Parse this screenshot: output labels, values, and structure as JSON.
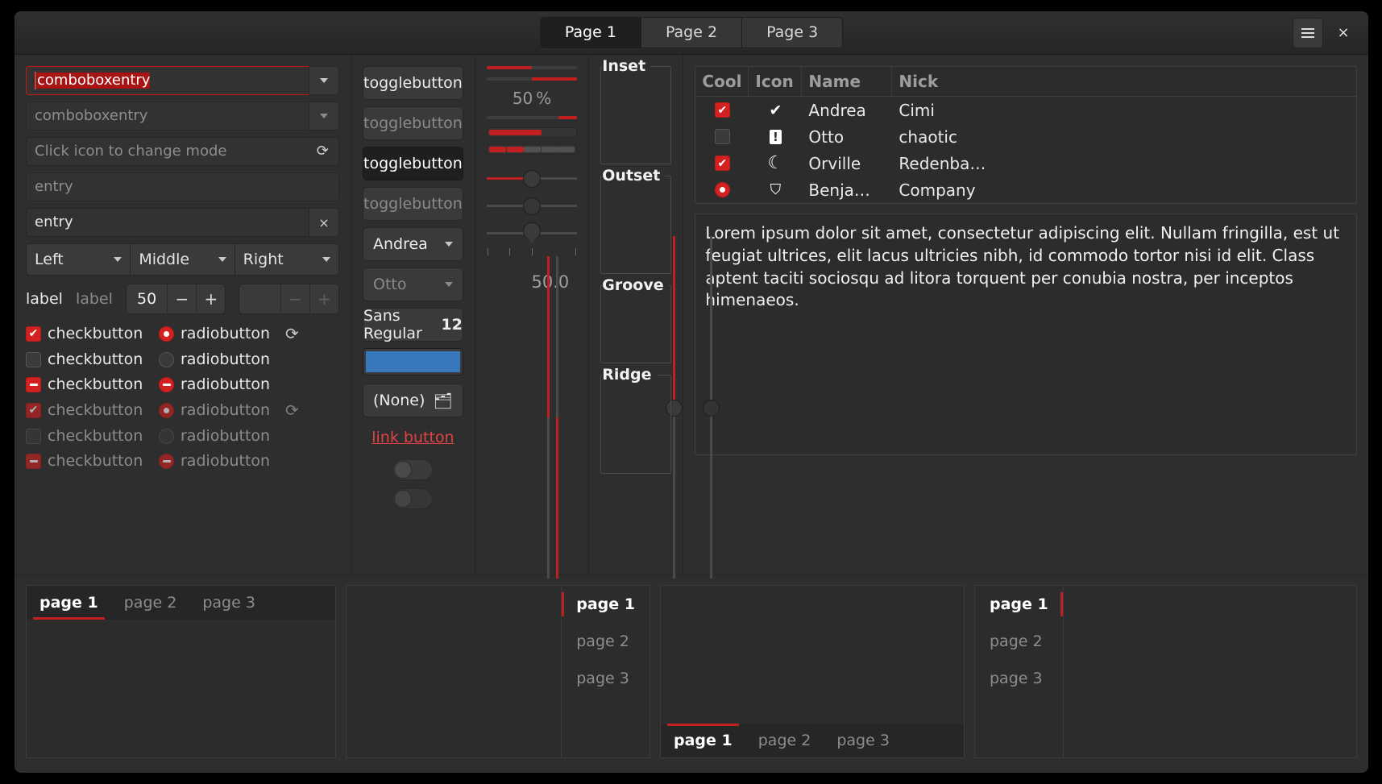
{
  "header": {
    "tabs": [
      {
        "label": "Page 1",
        "active": true
      },
      {
        "label": "Page 2",
        "active": false
      },
      {
        "label": "Page 3",
        "active": false
      }
    ],
    "menu_icon": "hamburger-menu-icon",
    "close_label": "×"
  },
  "col1": {
    "combo_entry_focused": {
      "value": "comboboxentry",
      "selected_text": "comboboxentry"
    },
    "combo_entry_placeholder": {
      "placeholder": "comboboxentry"
    },
    "icon_entry": {
      "placeholder": "Click icon to change mode",
      "icon": "refresh-icon"
    },
    "entry_placeholder": {
      "placeholder": "entry"
    },
    "entry_with_clear": {
      "value": "entry",
      "clear_icon": "×"
    },
    "segmented": [
      {
        "label": "Left"
      },
      {
        "label": "Middle"
      },
      {
        "label": "Right"
      }
    ],
    "labels": {
      "normal": "label",
      "dim": "label"
    },
    "spin": {
      "value": "50",
      "minus": "−",
      "plus": "+"
    },
    "spin_disabled": {
      "value": "",
      "minus": "−",
      "plus": "+"
    },
    "check_rows": [
      {
        "check_state": "on",
        "check_label": "checkbutton",
        "radio_state": "on",
        "radio_label": "radiobutton",
        "spinner": true,
        "disabled": false
      },
      {
        "check_state": "off",
        "check_label": "checkbutton",
        "radio_state": "off",
        "radio_label": "radiobutton",
        "spinner": false,
        "disabled": false
      },
      {
        "check_state": "mixed",
        "check_label": "checkbutton",
        "radio_state": "mixed",
        "radio_label": "radiobutton",
        "spinner": false,
        "disabled": false
      },
      {
        "check_state": "on",
        "check_label": "checkbutton",
        "radio_state": "on",
        "radio_label": "radiobutton",
        "spinner": true,
        "disabled": true
      },
      {
        "check_state": "off",
        "check_label": "checkbutton",
        "radio_state": "off",
        "radio_label": "radiobutton",
        "spinner": false,
        "disabled": true
      },
      {
        "check_state": "mixed",
        "check_label": "checkbutton",
        "radio_state": "mixed",
        "radio_label": "radiobutton",
        "spinner": false,
        "disabled": true
      }
    ]
  },
  "col2": {
    "toggles": [
      {
        "label": "togglebutton",
        "state": "normal"
      },
      {
        "label": "togglebutton",
        "state": "disabled"
      },
      {
        "label": "togglebutton",
        "state": "pressed"
      },
      {
        "label": "togglebutton",
        "state": "disabled"
      }
    ],
    "combo_andrea": "Andrea",
    "combo_otto": "Otto",
    "font_button": {
      "family": "Sans Regular",
      "size": "12"
    },
    "color_button": {
      "color": "#3778bd"
    },
    "file_button": {
      "label": "(None)",
      "icon": "folder-icon"
    },
    "link_button": "link button",
    "switch_on": "off",
    "switch_off": "off"
  },
  "col3": {
    "progress_ltr_pct": 50,
    "progress_rtl_pct": 50,
    "percent_label": "50 %",
    "progress_thin_pct": 20,
    "level_bar_pct": 60,
    "level_discrete": [
      1,
      1,
      0,
      0,
      0
    ],
    "scale_value_pct": 50,
    "scale2_value_pct": 50,
    "scale3_value_pct": 50,
    "marks": [
      0,
      25,
      50,
      100
    ],
    "value_label": "50.0",
    "vscale_value_pct": 50
  },
  "col4": {
    "frames": [
      {
        "title": "Inset"
      },
      {
        "title": "Outset"
      },
      {
        "title": "Groove"
      },
      {
        "title": "Ridge"
      }
    ]
  },
  "col5": {
    "table": {
      "columns": [
        "Cool",
        "Icon",
        "Name",
        "Nick"
      ],
      "rows": [
        {
          "cool": "check-on",
          "icon": "✔",
          "icon_name": "check-circle-icon",
          "name": "Andrea",
          "nick": "Cimi"
        },
        {
          "cool": "check-off",
          "icon": "!",
          "icon_name": "warning-icon",
          "name": "Otto",
          "nick": "chaotic"
        },
        {
          "cool": "check-on",
          "icon": "☾",
          "icon_name": "moon-icon",
          "name": "Orville",
          "nick": "Redenba…"
        },
        {
          "cool": "radio-on",
          "icon": "⛉",
          "icon_name": "monkey-icon",
          "name": "Benja…",
          "nick": "Company"
        }
      ]
    },
    "textview": "Lorem ipsum dolor sit amet, consectetur adipiscing elit. Nullam fringilla, est ut feugiat ultrices, elit lacus ultricies nibh, id commodo tortor nisi id elit.\nClass aptent taciti sociosqu ad litora torquent per conubia nostra, per inceptos himenaeos."
  },
  "notebooks": [
    {
      "position": "top",
      "tabs": [
        {
          "label": "page 1",
          "active": true
        },
        {
          "label": "page 2",
          "active": false
        },
        {
          "label": "page 3",
          "active": false
        }
      ]
    },
    {
      "position": "right",
      "tabs": [
        {
          "label": "page 1",
          "active": true
        },
        {
          "label": "page 2",
          "active": false
        },
        {
          "label": "page 3",
          "active": false
        }
      ]
    },
    {
      "position": "bottom",
      "tabs": [
        {
          "label": "page 1",
          "active": true
        },
        {
          "label": "page 2",
          "active": false
        },
        {
          "label": "page 3",
          "active": false
        }
      ]
    },
    {
      "position": "left",
      "tabs": [
        {
          "label": "page 1",
          "active": true
        },
        {
          "label": "page 2",
          "active": false
        },
        {
          "label": "page 3",
          "active": false
        }
      ]
    }
  ],
  "colors": {
    "accent_red": "#c22020",
    "window_bg": "#2e2e2e",
    "widget_bg": "#3a3a3a",
    "link": "#e04343",
    "color_swatch": "#3778bd"
  }
}
